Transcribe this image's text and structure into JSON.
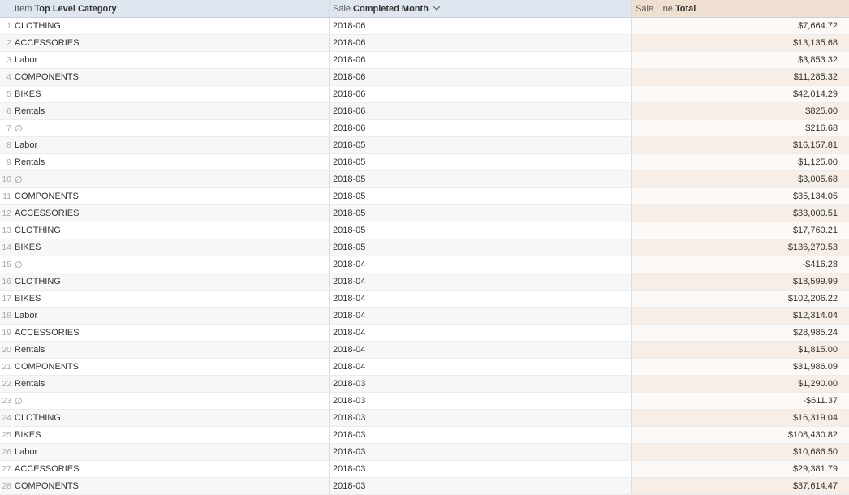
{
  "header": {
    "col1_prefix": "Item",
    "col1_bold": "Top Level Category",
    "col2_prefix": "Sale",
    "col2_bold": "Completed Month",
    "col2_sort_icon": "chevron-down-icon",
    "col3_prefix": "Sale Line",
    "col3_bold": "Total"
  },
  "rows": [
    {
      "n": "1",
      "category": "CLOTHING",
      "month": "2018-06",
      "total": "$7,664.72"
    },
    {
      "n": "2",
      "category": "ACCESSORIES",
      "month": "2018-06",
      "total": "$13,135.68"
    },
    {
      "n": "3",
      "category": "Labor",
      "month": "2018-06",
      "total": "$3,853.32"
    },
    {
      "n": "4",
      "category": "COMPONENTS",
      "month": "2018-06",
      "total": "$11,285.32"
    },
    {
      "n": "5",
      "category": "BIKES",
      "month": "2018-06",
      "total": "$42,014.29"
    },
    {
      "n": "6",
      "category": "Rentals",
      "month": "2018-06",
      "total": "$825.00"
    },
    {
      "n": "7",
      "category": "∅",
      "month": "2018-06",
      "total": "$216.68"
    },
    {
      "n": "8",
      "category": "Labor",
      "month": "2018-05",
      "total": "$16,157.81"
    },
    {
      "n": "9",
      "category": "Rentals",
      "month": "2018-05",
      "total": "$1,125.00"
    },
    {
      "n": "10",
      "category": "∅",
      "month": "2018-05",
      "total": "$3,005.68"
    },
    {
      "n": "11",
      "category": "COMPONENTS",
      "month": "2018-05",
      "total": "$35,134.05"
    },
    {
      "n": "12",
      "category": "ACCESSORIES",
      "month": "2018-05",
      "total": "$33,000.51"
    },
    {
      "n": "13",
      "category": "CLOTHING",
      "month": "2018-05",
      "total": "$17,760.21"
    },
    {
      "n": "14",
      "category": "BIKES",
      "month": "2018-05",
      "total": "$136,270.53"
    },
    {
      "n": "15",
      "category": "∅",
      "month": "2018-04",
      "total": "-$416.28"
    },
    {
      "n": "16",
      "category": "CLOTHING",
      "month": "2018-04",
      "total": "$18,599.99"
    },
    {
      "n": "17",
      "category": "BIKES",
      "month": "2018-04",
      "total": "$102,206.22"
    },
    {
      "n": "18",
      "category": "Labor",
      "month": "2018-04",
      "total": "$12,314.04"
    },
    {
      "n": "19",
      "category": "ACCESSORIES",
      "month": "2018-04",
      "total": "$28,985.24"
    },
    {
      "n": "20",
      "category": "Rentals",
      "month": "2018-04",
      "total": "$1,815.00"
    },
    {
      "n": "21",
      "category": "COMPONENTS",
      "month": "2018-04",
      "total": "$31,986.09"
    },
    {
      "n": "22",
      "category": "Rentals",
      "month": "2018-03",
      "total": "$1,290.00"
    },
    {
      "n": "23",
      "category": "∅",
      "month": "2018-03",
      "total": "-$611.37"
    },
    {
      "n": "24",
      "category": "CLOTHING",
      "month": "2018-03",
      "total": "$16,319.04"
    },
    {
      "n": "25",
      "category": "BIKES",
      "month": "2018-03",
      "total": "$108,430.82"
    },
    {
      "n": "26",
      "category": "Labor",
      "month": "2018-03",
      "total": "$10,686.50"
    },
    {
      "n": "27",
      "category": "ACCESSORIES",
      "month": "2018-03",
      "total": "$29,381.79"
    },
    {
      "n": "28",
      "category": "COMPONENTS",
      "month": "2018-03",
      "total": "$37,614.47"
    }
  ],
  "colors": {
    "header_bg": "#dfe6ef",
    "measure_header_bg": "#efdfd0",
    "measure_cell_bg": "#f7efe7",
    "row_stripe": "#f5f7f9"
  }
}
